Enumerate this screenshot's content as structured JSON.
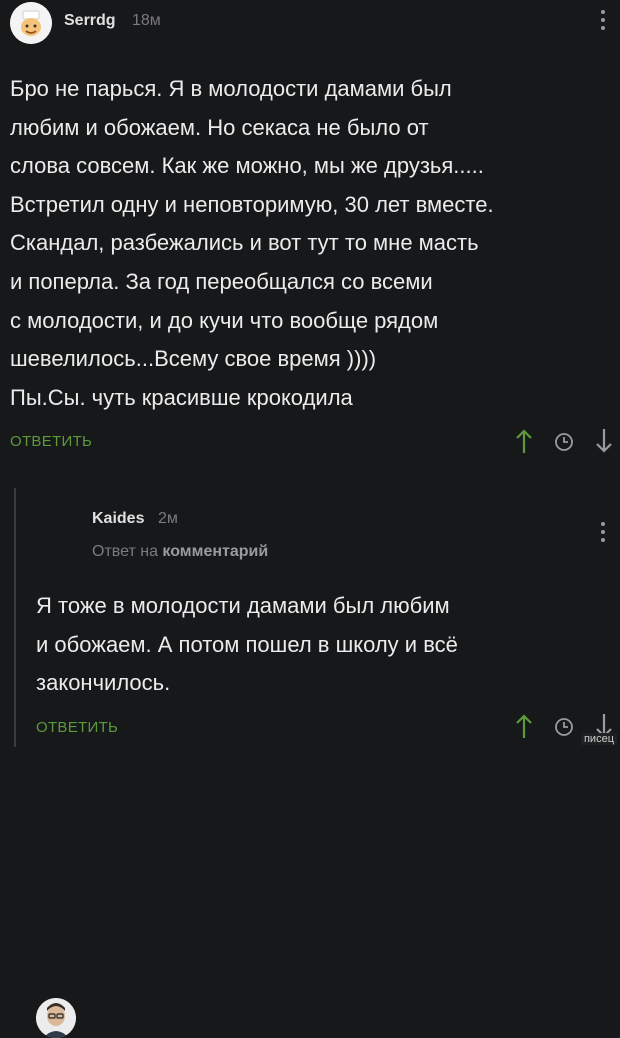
{
  "comments": [
    {
      "username": "Serrdg",
      "time": "18м",
      "text": "Бро не парься. Я в молодости дамами был\nлюбим и обожаем. Но секаса не было от\nслова совсем. Как же можно, мы же друзья.....\nВстретил одну и неповторимую, 30 лет вместе.\nСкандал, разбежались и вот тут то мне масть\nи поперла. За год переобщался со всеми\nс молодости, и до кучи что вообще рядом\nшевелилось...Всему свое время ))))\nПы.Сы. чуть красивше крокодила",
      "reply_label": "ОТВЕТИТЬ"
    },
    {
      "username": "Kaides",
      "time": "2м",
      "reply_to_prefix": "Ответ на",
      "reply_to_target": "комментарий",
      "text": "Я тоже в молодости дамами был любим\nи обожаем. А потом пошел в школу и всё\nзакончилось.",
      "reply_label": "ОТВЕТИТЬ"
    }
  ],
  "icons": {
    "upvote": "arrow-up-icon",
    "save": "clock-icon",
    "downvote": "arrow-down-icon",
    "menu": "more-vertical-icon"
  },
  "colors": {
    "background": "#17181a",
    "text": "#ebebeb",
    "accent_green": "#5d9a3c",
    "muted": "#7a7b7e"
  },
  "watermark": "писец"
}
